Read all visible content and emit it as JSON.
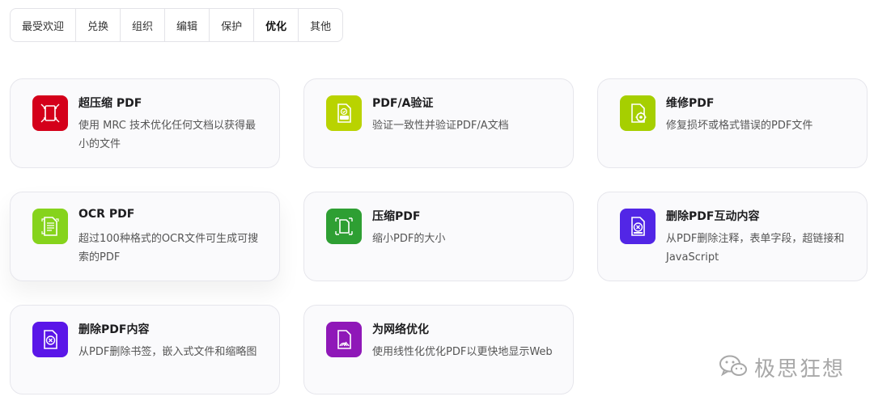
{
  "tabs": [
    {
      "label": "最受欢迎"
    },
    {
      "label": "兑换"
    },
    {
      "label": "组织"
    },
    {
      "label": "编辑"
    },
    {
      "label": "保护"
    },
    {
      "label": "优化",
      "active": true
    },
    {
      "label": "其他"
    }
  ],
  "cards": [
    {
      "title": "超压缩 PDF",
      "desc": "使用 MRC 技术优化任何文档以获得最小的文件",
      "icon": "super-compress-icon",
      "color": "#d4001a"
    },
    {
      "title": "PDF/A验证",
      "desc": "验证一致性并验证PDF/A文档",
      "icon": "pdfa-validate-icon",
      "color": "#b9d300"
    },
    {
      "title": "维修PDF",
      "desc": "修复损坏或格式错误的PDF文件",
      "icon": "repair-gear-icon",
      "color": "#a6cf00"
    },
    {
      "title": "OCR PDF",
      "desc": "超过100种格式的OCR文件可生成可搜索的PDF",
      "icon": "ocr-document-icon",
      "color": "#86d31c"
    },
    {
      "title": "压缩PDF",
      "desc": "缩小PDF的大小",
      "icon": "compress-icon",
      "color": "#2e9f33"
    },
    {
      "title": "删除PDF互动内容",
      "desc": "从PDF删除注释，表单字段，超链接和JavaScript",
      "icon": "remove-interactive-icon",
      "color": "#5226e6"
    },
    {
      "title": "删除PDF内容",
      "desc": "从PDF删除书签，嵌入式文件和缩略图",
      "icon": "remove-content-icon",
      "color": "#5a16e8"
    },
    {
      "title": "为网络优化",
      "desc": "使用线性化优化PDF以更快地显示Web",
      "icon": "web-optimize-icon",
      "color": "#8f18b8"
    }
  ],
  "watermark": {
    "text": "极思狂想",
    "icon": "wechat-icon"
  }
}
